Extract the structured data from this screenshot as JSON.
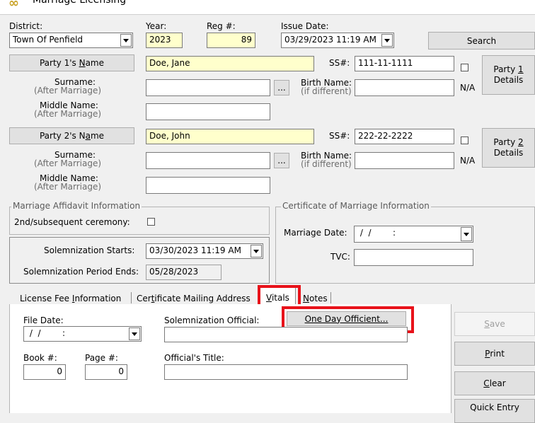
{
  "window": {
    "title": "Marriage Licensing"
  },
  "header": {
    "district_label": "District:",
    "district_value": "Town Of Penfield",
    "year_label": "Year:",
    "year_value": "2023",
    "reg_label": "Reg #:",
    "reg_value": "89",
    "issue_date_label": "Issue Date:",
    "issue_date_value": "03/29/2023 11:19 AM",
    "search_label": "Search"
  },
  "party1": {
    "name_button": "Party 1's Name",
    "name_value": "Doe, Jane",
    "ss_label": "SS#:",
    "ss_value": "111-11-1111",
    "surname_label": "Surname:",
    "surname_sub": "(After Marriage)",
    "surname_value": "",
    "ellipsis": "...",
    "birth_name_label": "Birth Name:",
    "birth_name_sub": "(if different)",
    "birth_name_value": "",
    "na_label": "N/A",
    "middle_label": "Middle Name:",
    "middle_sub": "(After Marriage)",
    "middle_value": "",
    "details_line1": "Party 1",
    "details_line2": "Details"
  },
  "party2": {
    "name_button": "Party 2's Name",
    "name_value": "Doe, John",
    "ss_label": "SS#:",
    "ss_value": "222-22-2222",
    "surname_label": "Surname:",
    "surname_sub": "(After Marriage)",
    "surname_value": "",
    "ellipsis": "...",
    "birth_name_label": "Birth Name:",
    "birth_name_sub": "(if different)",
    "birth_name_value": "",
    "na_label": "N/A",
    "middle_label": "Middle Name:",
    "middle_sub": "(After Marriage)",
    "middle_value": "",
    "details_line1": "Party 2",
    "details_line2": "Details"
  },
  "affidavit": {
    "legend": "Marriage Affidavit Information",
    "ceremony_label": "2nd/subsequent ceremony:"
  },
  "solemnization": {
    "starts_label": "Solemnization Starts:",
    "starts_value": "03/30/2023 11:19 AM",
    "ends_label": "Solemnization Period Ends:",
    "ends_value": "05/28/2023"
  },
  "certificate": {
    "legend": "Certificate of Marriage Information",
    "marriage_date_label": "Marriage Date:",
    "marriage_date_value": " /  /        :",
    "tvc_label": "TVC:",
    "tvc_value": ""
  },
  "tabs": [
    {
      "label": "License Fee Information"
    },
    {
      "label": "Certificate Mailing Address"
    },
    {
      "label": "Vitals"
    },
    {
      "label": "Notes"
    }
  ],
  "vitals": {
    "file_date_label": "File Date:",
    "file_date_value": " /  /        :",
    "solemnization_official_label": "Solemnization Official:",
    "one_day_button": "One Day Officient...",
    "official_value": "",
    "book_label": "Book #:",
    "book_value": "0",
    "page_label": "Page #:",
    "page_value": "0",
    "official_title_label": "Official's Title:",
    "official_title_value": ""
  },
  "actions": {
    "save": "Save",
    "print": "Print",
    "clear": "Clear",
    "quick_entry": "Quick Entry"
  },
  "colors": {
    "highlight": "#e8121a",
    "required_field": "#ffffcc"
  }
}
